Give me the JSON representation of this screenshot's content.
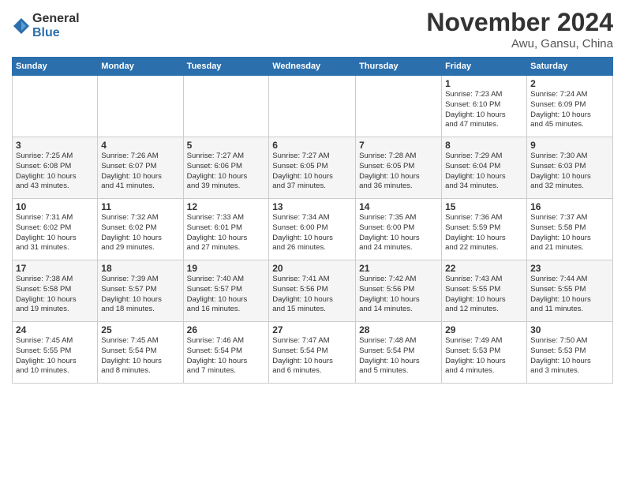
{
  "header": {
    "logo_general": "General",
    "logo_blue": "Blue",
    "title": "November 2024",
    "location": "Awu, Gansu, China"
  },
  "weekdays": [
    "Sunday",
    "Monday",
    "Tuesday",
    "Wednesday",
    "Thursday",
    "Friday",
    "Saturday"
  ],
  "weeks": [
    [
      {
        "day": "",
        "info": ""
      },
      {
        "day": "",
        "info": ""
      },
      {
        "day": "",
        "info": ""
      },
      {
        "day": "",
        "info": ""
      },
      {
        "day": "",
        "info": ""
      },
      {
        "day": "1",
        "info": "Sunrise: 7:23 AM\nSunset: 6:10 PM\nDaylight: 10 hours\nand 47 minutes."
      },
      {
        "day": "2",
        "info": "Sunrise: 7:24 AM\nSunset: 6:09 PM\nDaylight: 10 hours\nand 45 minutes."
      }
    ],
    [
      {
        "day": "3",
        "info": "Sunrise: 7:25 AM\nSunset: 6:08 PM\nDaylight: 10 hours\nand 43 minutes."
      },
      {
        "day": "4",
        "info": "Sunrise: 7:26 AM\nSunset: 6:07 PM\nDaylight: 10 hours\nand 41 minutes."
      },
      {
        "day": "5",
        "info": "Sunrise: 7:27 AM\nSunset: 6:06 PM\nDaylight: 10 hours\nand 39 minutes."
      },
      {
        "day": "6",
        "info": "Sunrise: 7:27 AM\nSunset: 6:05 PM\nDaylight: 10 hours\nand 37 minutes."
      },
      {
        "day": "7",
        "info": "Sunrise: 7:28 AM\nSunset: 6:05 PM\nDaylight: 10 hours\nand 36 minutes."
      },
      {
        "day": "8",
        "info": "Sunrise: 7:29 AM\nSunset: 6:04 PM\nDaylight: 10 hours\nand 34 minutes."
      },
      {
        "day": "9",
        "info": "Sunrise: 7:30 AM\nSunset: 6:03 PM\nDaylight: 10 hours\nand 32 minutes."
      }
    ],
    [
      {
        "day": "10",
        "info": "Sunrise: 7:31 AM\nSunset: 6:02 PM\nDaylight: 10 hours\nand 31 minutes."
      },
      {
        "day": "11",
        "info": "Sunrise: 7:32 AM\nSunset: 6:02 PM\nDaylight: 10 hours\nand 29 minutes."
      },
      {
        "day": "12",
        "info": "Sunrise: 7:33 AM\nSunset: 6:01 PM\nDaylight: 10 hours\nand 27 minutes."
      },
      {
        "day": "13",
        "info": "Sunrise: 7:34 AM\nSunset: 6:00 PM\nDaylight: 10 hours\nand 26 minutes."
      },
      {
        "day": "14",
        "info": "Sunrise: 7:35 AM\nSunset: 6:00 PM\nDaylight: 10 hours\nand 24 minutes."
      },
      {
        "day": "15",
        "info": "Sunrise: 7:36 AM\nSunset: 5:59 PM\nDaylight: 10 hours\nand 22 minutes."
      },
      {
        "day": "16",
        "info": "Sunrise: 7:37 AM\nSunset: 5:58 PM\nDaylight: 10 hours\nand 21 minutes."
      }
    ],
    [
      {
        "day": "17",
        "info": "Sunrise: 7:38 AM\nSunset: 5:58 PM\nDaylight: 10 hours\nand 19 minutes."
      },
      {
        "day": "18",
        "info": "Sunrise: 7:39 AM\nSunset: 5:57 PM\nDaylight: 10 hours\nand 18 minutes."
      },
      {
        "day": "19",
        "info": "Sunrise: 7:40 AM\nSunset: 5:57 PM\nDaylight: 10 hours\nand 16 minutes."
      },
      {
        "day": "20",
        "info": "Sunrise: 7:41 AM\nSunset: 5:56 PM\nDaylight: 10 hours\nand 15 minutes."
      },
      {
        "day": "21",
        "info": "Sunrise: 7:42 AM\nSunset: 5:56 PM\nDaylight: 10 hours\nand 14 minutes."
      },
      {
        "day": "22",
        "info": "Sunrise: 7:43 AM\nSunset: 5:55 PM\nDaylight: 10 hours\nand 12 minutes."
      },
      {
        "day": "23",
        "info": "Sunrise: 7:44 AM\nSunset: 5:55 PM\nDaylight: 10 hours\nand 11 minutes."
      }
    ],
    [
      {
        "day": "24",
        "info": "Sunrise: 7:45 AM\nSunset: 5:55 PM\nDaylight: 10 hours\nand 10 minutes."
      },
      {
        "day": "25",
        "info": "Sunrise: 7:45 AM\nSunset: 5:54 PM\nDaylight: 10 hours\nand 8 minutes."
      },
      {
        "day": "26",
        "info": "Sunrise: 7:46 AM\nSunset: 5:54 PM\nDaylight: 10 hours\nand 7 minutes."
      },
      {
        "day": "27",
        "info": "Sunrise: 7:47 AM\nSunset: 5:54 PM\nDaylight: 10 hours\nand 6 minutes."
      },
      {
        "day": "28",
        "info": "Sunrise: 7:48 AM\nSunset: 5:54 PM\nDaylight: 10 hours\nand 5 minutes."
      },
      {
        "day": "29",
        "info": "Sunrise: 7:49 AM\nSunset: 5:53 PM\nDaylight: 10 hours\nand 4 minutes."
      },
      {
        "day": "30",
        "info": "Sunrise: 7:50 AM\nSunset: 5:53 PM\nDaylight: 10 hours\nand 3 minutes."
      }
    ]
  ]
}
